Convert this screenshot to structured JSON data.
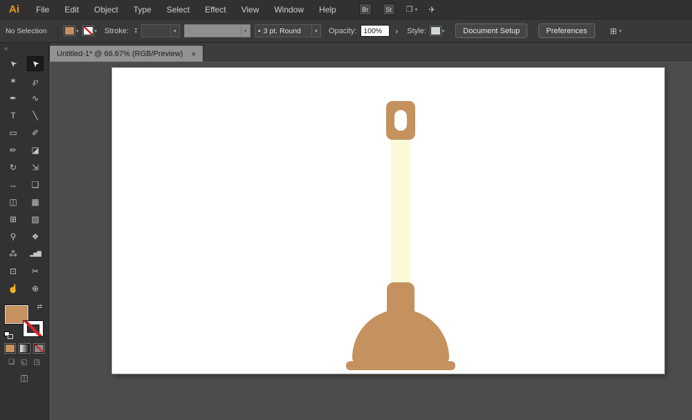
{
  "app": {
    "logo": "Ai"
  },
  "menubar": {
    "items": [
      "File",
      "Edit",
      "Object",
      "Type",
      "Select",
      "Effect",
      "View",
      "Window",
      "Help"
    ],
    "bridge_label": "Br",
    "stock_label": "St"
  },
  "icons": {
    "chevron_down": "▾",
    "stepper_up": "▴",
    "stepper_down": "▾",
    "submenu_arrow": "›",
    "arrange_documents": "❒",
    "gpu_performance": "✈",
    "transform_grid": "⊞",
    "draw_normal": "❏",
    "draw_behind": "◱",
    "draw_inside": "◳",
    "screen_mode": "◫"
  },
  "control_bar": {
    "selection_status": "No Selection",
    "stroke_label": "Stroke:",
    "brush_bullet": "•",
    "brush_value": "3 pt. Round",
    "opacity_label": "Opacity:",
    "opacity_value": "100%",
    "style_label": "Style:",
    "document_setup_label": "Document Setup",
    "preferences_label": "Preferences"
  },
  "tab": {
    "title": "Untitled-1* @ 66.67% (RGB/Preview)",
    "close_glyph": "×"
  },
  "toolbar": {
    "collapse_glyph": "«",
    "swap_glyph": "⇄",
    "tools": [
      {
        "name": "selection",
        "glyph": "➤"
      },
      {
        "name": "direct-selection",
        "glyph": "➤",
        "active": true
      },
      {
        "name": "magic-wand",
        "glyph": "✶"
      },
      {
        "name": "lasso",
        "glyph": "℘"
      },
      {
        "name": "pen",
        "glyph": "✒"
      },
      {
        "name": "curvature",
        "glyph": "∿"
      },
      {
        "name": "type",
        "glyph": "T"
      },
      {
        "name": "line-segment",
        "glyph": "╲"
      },
      {
        "name": "rectangle",
        "glyph": "▭"
      },
      {
        "name": "paintbrush",
        "glyph": "✐"
      },
      {
        "name": "pencil",
        "glyph": "✏"
      },
      {
        "name": "eraser",
        "glyph": "◪"
      },
      {
        "name": "rotate",
        "glyph": "↻"
      },
      {
        "name": "scale",
        "glyph": "⇲"
      },
      {
        "name": "width",
        "glyph": "↔"
      },
      {
        "name": "free-transform",
        "glyph": "❏"
      },
      {
        "name": "shape-builder",
        "glyph": "◫"
      },
      {
        "name": "perspective-grid",
        "glyph": "▦"
      },
      {
        "name": "mesh",
        "glyph": "⊞"
      },
      {
        "name": "gradient",
        "glyph": "▧"
      },
      {
        "name": "eyedropper",
        "glyph": "⚲"
      },
      {
        "name": "blend",
        "glyph": "❖"
      },
      {
        "name": "symbol-sprayer",
        "glyph": "⁂"
      },
      {
        "name": "column-graph",
        "glyph": "▂▅▇"
      },
      {
        "name": "artboard",
        "glyph": "⊡"
      },
      {
        "name": "slice",
        "glyph": "✂"
      },
      {
        "name": "hand",
        "glyph": "☝"
      },
      {
        "name": "zoom",
        "glyph": "⊕"
      }
    ]
  },
  "swatches": {
    "fill": "#c4915f",
    "stroke": "None"
  },
  "artwork": {
    "subject": "plunger",
    "handle_color": "#c4915f",
    "stick_color": "#fafad6",
    "hole_color": "#ffffff"
  }
}
